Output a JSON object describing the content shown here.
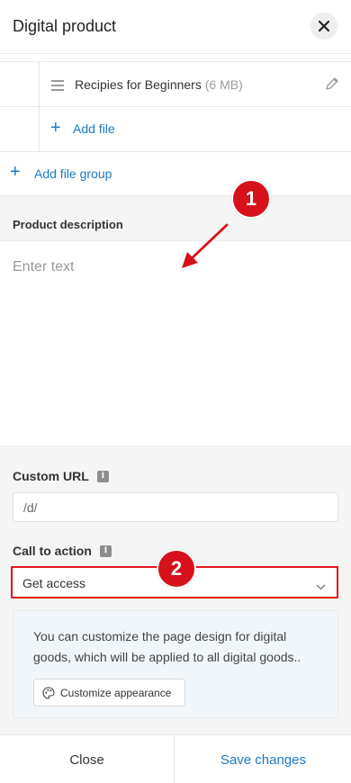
{
  "header": {
    "title": "Digital product",
    "close_icon": "close-icon"
  },
  "files": [
    {
      "name": "Recipies for Beginners",
      "size": "(6 MB)"
    }
  ],
  "add_file_label": "Add file",
  "add_file_group_label": "Add file group",
  "description": {
    "label": "Product description",
    "placeholder": "Enter text"
  },
  "custom_url": {
    "label": "Custom URL",
    "info": "i",
    "value": "/d/"
  },
  "call_to_action": {
    "label": "Call to action",
    "info": "i",
    "value": "Get access"
  },
  "info_box": {
    "text": "You can customize the page design for digital goods, which will be applied to all digital goods..",
    "button_label": "Customize appearance"
  },
  "footer": {
    "close_label": "Close",
    "save_label": "Save changes"
  },
  "annotations": {
    "marker1": "1",
    "marker2": "2"
  },
  "colors": {
    "accent": "#1b7ac4",
    "marker": "#d6111c",
    "highlight_border": "#e3151e"
  }
}
